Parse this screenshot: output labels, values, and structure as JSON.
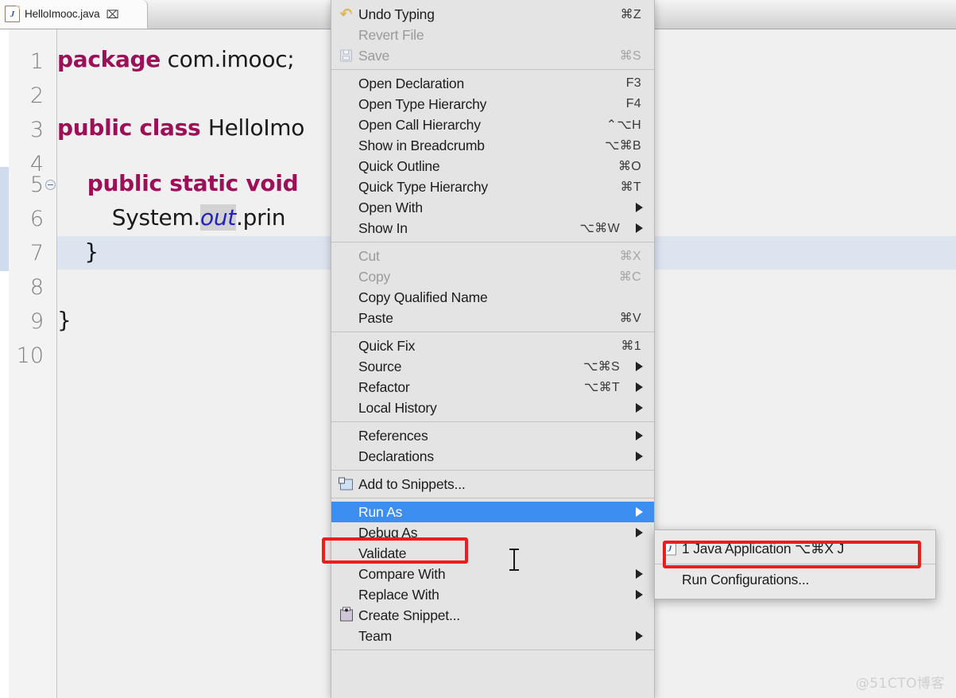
{
  "window": {
    "app": "Eclipse IDE",
    "watermark": "@51CTO博客"
  },
  "editor": {
    "tab": {
      "label": "HelloImooc.java",
      "icon": "java-file-icon",
      "icon_letter": "J",
      "close_glyph": "⌧"
    },
    "gutter": {
      "line_numbers": [
        "1",
        "2",
        "3",
        "4",
        "5",
        "6",
        "7",
        "8",
        "9",
        "10"
      ],
      "fold_marker": "collapse-marker"
    },
    "code": {
      "lines": [
        {
          "n": "1",
          "tokens": [
            {
              "t": "package",
              "c": "kw"
            },
            {
              "t": " com.imooc;",
              "c": "plain"
            }
          ]
        },
        {
          "n": "2",
          "tokens": []
        },
        {
          "n": "3",
          "tokens": [
            {
              "t": "public class ",
              "c": "kw"
            },
            {
              "t": "HelloImo",
              "c": "plain"
            }
          ]
        },
        {
          "n": "4",
          "tokens": []
        },
        {
          "n": "5",
          "tokens": [
            {
              "t": "    public static void ",
              "c": "kw"
            }
          ]
        },
        {
          "n": "6",
          "tokens": [
            {
              "t": "        System.",
              "c": "plain"
            },
            {
              "t": "out",
              "c": "field"
            },
            {
              "t": ".prin",
              "c": "plain"
            }
          ]
        },
        {
          "n": "7",
          "tokens": [
            {
              "t": "    }",
              "c": "plain"
            }
          ]
        },
        {
          "n": "8",
          "tokens": []
        },
        {
          "n": "9",
          "tokens": [
            {
              "t": "}",
              "c": "plain"
            }
          ]
        },
        {
          "n": "10",
          "tokens": []
        }
      ],
      "current_line": "7",
      "selected_token": "out"
    }
  },
  "context_menu": {
    "groups": [
      {
        "items": [
          {
            "label": "Undo Typing",
            "accel": "⌘Z",
            "icon": "undo-icon",
            "disabled": false
          },
          {
            "label": "Revert File",
            "accel": "",
            "icon": "",
            "disabled": true
          },
          {
            "label": "Save",
            "accel": "⌘S",
            "icon": "save-icon",
            "disabled": true
          }
        ]
      },
      {
        "items": [
          {
            "label": "Open Declaration",
            "accel": "F3",
            "icon": "",
            "disabled": false
          },
          {
            "label": "Open Type Hierarchy",
            "accel": "F4",
            "icon": "",
            "disabled": false
          },
          {
            "label": "Open Call Hierarchy",
            "accel": "⌃⌥H",
            "icon": "",
            "disabled": false
          },
          {
            "label": "Show in Breadcrumb",
            "accel": "⌥⌘B",
            "icon": "",
            "disabled": false
          },
          {
            "label": "Quick Outline",
            "accel": "⌘O",
            "icon": "",
            "disabled": false
          },
          {
            "label": "Quick Type Hierarchy",
            "accel": "⌘T",
            "icon": "",
            "disabled": false
          },
          {
            "label": "Open With",
            "accel": "",
            "icon": "",
            "disabled": false,
            "submenu": true
          },
          {
            "label": "Show In",
            "accel": "⌥⌘W",
            "icon": "",
            "disabled": false,
            "submenu": true
          }
        ]
      },
      {
        "items": [
          {
            "label": "Cut",
            "accel": "⌘X",
            "icon": "",
            "disabled": true
          },
          {
            "label": "Copy",
            "accel": "⌘C",
            "icon": "",
            "disabled": true
          },
          {
            "label": "Copy Qualified Name",
            "accel": "",
            "icon": "",
            "disabled": false
          },
          {
            "label": "Paste",
            "accel": "⌘V",
            "icon": "",
            "disabled": false
          }
        ]
      },
      {
        "items": [
          {
            "label": "Quick Fix",
            "accel": "⌘1",
            "icon": "",
            "disabled": false
          },
          {
            "label": "Source",
            "accel": "⌥⌘S",
            "icon": "",
            "disabled": false,
            "submenu": true
          },
          {
            "label": "Refactor",
            "accel": "⌥⌘T",
            "icon": "",
            "disabled": false,
            "submenu": true
          },
          {
            "label": "Local History",
            "accel": "",
            "icon": "",
            "disabled": false,
            "submenu": true
          }
        ]
      },
      {
        "items": [
          {
            "label": "References",
            "accel": "",
            "icon": "",
            "disabled": false,
            "submenu": true
          },
          {
            "label": "Declarations",
            "accel": "",
            "icon": "",
            "disabled": false,
            "submenu": true
          }
        ]
      },
      {
        "items": [
          {
            "label": "Add to Snippets...",
            "accel": "",
            "icon": "snippet-add-icon",
            "disabled": false
          }
        ]
      },
      {
        "items": [
          {
            "label": "Run As",
            "accel": "",
            "icon": "",
            "disabled": false,
            "submenu": true,
            "selected": true,
            "highlighted": true
          },
          {
            "label": "Debug As",
            "accel": "",
            "icon": "",
            "disabled": false,
            "submenu": true
          },
          {
            "label": "Validate",
            "accel": "",
            "icon": "",
            "disabled": false
          },
          {
            "label": "Compare With",
            "accel": "",
            "icon": "",
            "disabled": false,
            "submenu": true
          },
          {
            "label": "Replace With",
            "accel": "",
            "icon": "",
            "disabled": false,
            "submenu": true
          },
          {
            "label": "Create Snippet...",
            "accel": "",
            "icon": "snippet-create-icon",
            "disabled": false
          },
          {
            "label": "Team",
            "accel": "",
            "icon": "",
            "disabled": false,
            "submenu": true
          }
        ]
      }
    ]
  },
  "run_as_submenu": {
    "items": [
      {
        "label": "1 Java Application ⌥⌘X J",
        "accel": "",
        "icon": "java-app-icon",
        "highlighted": true
      },
      {
        "label": "Run Configurations...",
        "accel": "",
        "icon": "",
        "highlighted": false
      }
    ]
  },
  "annotations": {
    "highlight_color": "#ee1c1c",
    "selection_color": "#3c8ef0",
    "boxes": [
      "run-as",
      "java-application"
    ]
  }
}
